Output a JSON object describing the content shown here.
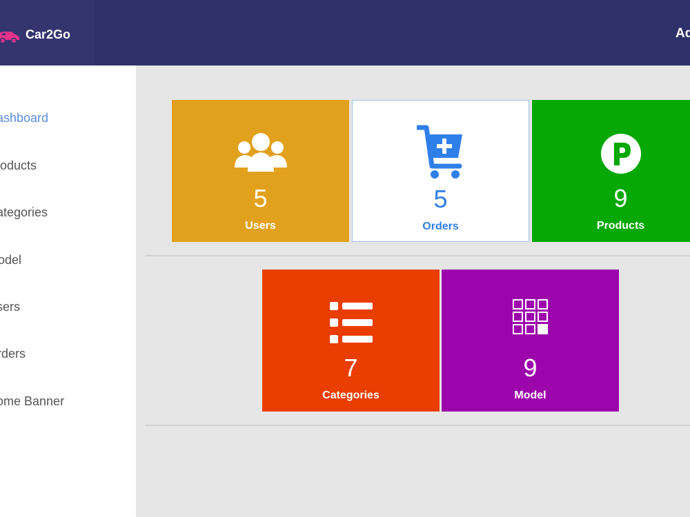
{
  "header": {
    "brand": "Car2Go",
    "user_label": "Admin",
    "bg_color": "#2f3069"
  },
  "sidebar": {
    "items": [
      {
        "label": "Dashboard",
        "active": true
      },
      {
        "label": "Products"
      },
      {
        "label": "Categories"
      },
      {
        "label": "Model"
      },
      {
        "label": "Users"
      },
      {
        "label": "Orders"
      },
      {
        "label": "Home Banner"
      }
    ],
    "active_color": "#5a8ee0"
  },
  "tiles": [
    {
      "label": "Users",
      "count": "5",
      "icon": "users-icon",
      "color": "#e2a11d"
    },
    {
      "label": "Orders",
      "count": "5",
      "icon": "cart-plus-icon",
      "color": "#ffffff",
      "text_color": "#2f7fe8"
    },
    {
      "label": "Products",
      "count": "9",
      "icon": "product-p-icon",
      "color": "#05a805"
    },
    {
      "label": "Categories",
      "count": "7",
      "icon": "list-icon",
      "color": "#ea3d00"
    },
    {
      "label": "Model",
      "count": "9",
      "icon": "grid-icon",
      "color": "#9c05ab"
    }
  ]
}
